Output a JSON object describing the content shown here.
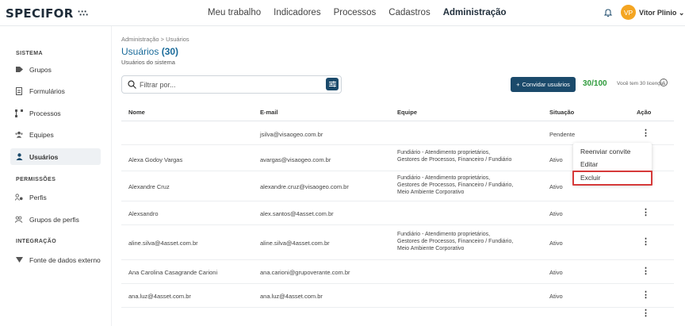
{
  "topbar": {
    "logo": "SPECIFOR",
    "logo_dots": "∵∴",
    "nav": [
      "Meu trabalho",
      "Indicadores",
      "Processos",
      "Cadastros",
      "Administração"
    ],
    "active_nav": "Administração",
    "avatar_initials": "VP",
    "user_name": "Vitor Plinio"
  },
  "sidebar": {
    "sections": [
      {
        "title": "SISTEMA",
        "items": [
          {
            "label": "Grupos",
            "icon": "tag-icon"
          },
          {
            "label": "Formulários",
            "icon": "document-icon"
          },
          {
            "label": "Processos",
            "icon": "flow-icon"
          },
          {
            "label": "Equipes",
            "icon": "team-icon"
          },
          {
            "label": "Usuários",
            "icon": "user-icon",
            "active": true
          }
        ]
      },
      {
        "title": "PERMISSÕES",
        "items": [
          {
            "label": "Perfis",
            "icon": "profile-icon"
          },
          {
            "label": "Grupos de perfis",
            "icon": "profile-group-icon"
          }
        ]
      },
      {
        "title": "INTEGRAÇÃO",
        "items": [
          {
            "label": "Fonte de dados externo",
            "icon": "data-source-icon"
          }
        ]
      }
    ]
  },
  "main": {
    "breadcrumb": "Administração > Usuários",
    "title": "Usuários",
    "count": "(30)",
    "subtitle": "Usuários do sistema",
    "search_placeholder": "Filtrar por...",
    "invite_label": "Convidar usuários",
    "quota": "30/100",
    "quota_note": "Você tem 30 licenças",
    "columns": [
      "Nome",
      "E-mail",
      "Equipe",
      "Situação",
      "Ação"
    ],
    "rows": [
      {
        "name": "",
        "email": "jsilva@visaogeo.com.br",
        "team": [],
        "status": "Pendente"
      },
      {
        "name": "Alexa Godoy Vargas",
        "email": "avargas@visaogeo.com.br",
        "team": [
          "Fundiário - Atendimento proprietários,",
          "Gestores de Processos, Financeiro / Fundiário"
        ],
        "status": "Ativo"
      },
      {
        "name": "Alexandre Cruz",
        "email": "alexandre.cruz@visaogeo.com.br",
        "team": [
          "Fundiário - Atendimento proprietários,",
          "Gestores de Processos, Financeiro / Fundiário,",
          "Meio Ambiente Corporativo"
        ],
        "status": "Ativo"
      },
      {
        "name": "Alexsandro",
        "email": "alex.santos@4asset.com.br",
        "team": [],
        "status": "Ativo"
      },
      {
        "name": "aline.silva@4asset.com.br",
        "email": "aline.silva@4asset.com.br",
        "team": [
          "Fundiário - Atendimento proprietários,",
          "Gestores de Processos, Financeiro / Fundiário,",
          "Meio Ambiente Corporativo"
        ],
        "status": "Ativo"
      },
      {
        "name": "Ana Carolina Casagrande Carioni",
        "email": "ana.carioni@grupoverante.com.br",
        "team": [],
        "status": "Ativo"
      },
      {
        "name": "ana.luz@4asset.com.br",
        "email": "ana.luz@4asset.com.br",
        "team": [],
        "status": "Ativo"
      }
    ],
    "action_menu": [
      "Reenviar convite",
      "Editar",
      "Excluir"
    ]
  }
}
